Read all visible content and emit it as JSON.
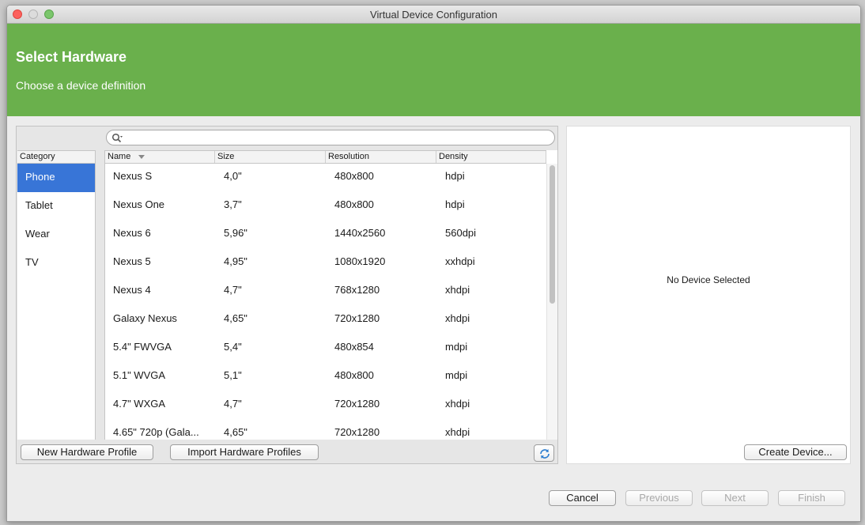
{
  "window": {
    "title": "Virtual Device Configuration"
  },
  "header": {
    "title": "Select Hardware",
    "subtitle": "Choose a device definition"
  },
  "search": {
    "value": ""
  },
  "category": {
    "header": "Category",
    "items": [
      "Phone",
      "Tablet",
      "Wear",
      "TV"
    ],
    "selected": "Phone"
  },
  "table": {
    "columns": [
      "Name",
      "Size",
      "Resolution",
      "Density"
    ],
    "rows": [
      {
        "name": "Nexus S",
        "size": "4,0\"",
        "resolution": "480x800",
        "density": "hdpi"
      },
      {
        "name": "Nexus One",
        "size": "3,7\"",
        "resolution": "480x800",
        "density": "hdpi"
      },
      {
        "name": "Nexus 6",
        "size": "5,96\"",
        "resolution": "1440x2560",
        "density": "560dpi"
      },
      {
        "name": "Nexus 5",
        "size": "4,95\"",
        "resolution": "1080x1920",
        "density": "xxhdpi"
      },
      {
        "name": "Nexus 4",
        "size": "4,7\"",
        "resolution": "768x1280",
        "density": "xhdpi"
      },
      {
        "name": "Galaxy Nexus",
        "size": "4,65\"",
        "resolution": "720x1280",
        "density": "xhdpi"
      },
      {
        "name": "5.4\" FWVGA",
        "size": "5,4\"",
        "resolution": "480x854",
        "density": "mdpi"
      },
      {
        "name": "5.1\" WVGA",
        "size": "5,1\"",
        "resolution": "480x800",
        "density": "mdpi"
      },
      {
        "name": "4.7\" WXGA",
        "size": "4,7\"",
        "resolution": "720x1280",
        "density": "xhdpi"
      },
      {
        "name": "4.65\" 720p (Gala...",
        "size": "4,65\"",
        "resolution": "720x1280",
        "density": "xhdpi"
      }
    ]
  },
  "buttons": {
    "new_profile": "New Hardware Profile",
    "import_profiles": "Import Hardware Profiles",
    "create_device": "Create Device...",
    "cancel": "Cancel",
    "previous": "Previous",
    "next": "Next",
    "finish": "Finish"
  },
  "detail": {
    "empty_text": "No Device Selected"
  },
  "colors": {
    "header_bg": "#6ab04c",
    "selection": "#3875d7"
  }
}
